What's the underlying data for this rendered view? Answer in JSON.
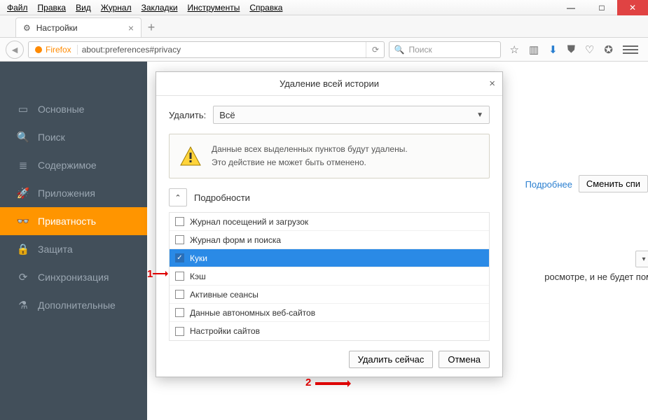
{
  "menubar": [
    "Файл",
    "Правка",
    "Вид",
    "Журнал",
    "Закладки",
    "Инструменты",
    "Справка"
  ],
  "tab": {
    "title": "Настройки"
  },
  "url": {
    "identity": "Firefox",
    "address": "about:preferences#privacy",
    "search_placeholder": "Поиск"
  },
  "sidebar": {
    "items": [
      {
        "icon": "▭",
        "label": "Основные"
      },
      {
        "icon": "🔍",
        "label": "Поиск"
      },
      {
        "icon": "≣",
        "label": "Содержимое"
      },
      {
        "icon": "🚀",
        "label": "Приложения"
      },
      {
        "icon": "👓",
        "label": "Приватность"
      },
      {
        "icon": "🔒",
        "label": "Защита"
      },
      {
        "icon": "⟳",
        "label": "Синхронизация"
      },
      {
        "icon": "⚗",
        "label": "Дополнительные"
      }
    ],
    "active_index": 4
  },
  "background": {
    "link": "Подробнее",
    "button": "Сменить спи",
    "text": "росмотре, и не будет пом"
  },
  "dialog": {
    "title": "Удаление всей истории",
    "delete_label": "Удалить:",
    "delete_value": "Всё",
    "warning_line1": "Данные всех выделенных пунктов будут удалены.",
    "warning_line2": "Это действие не может быть отменено.",
    "details_label": "Подробности",
    "items": [
      {
        "label": "Журнал посещений и загрузок",
        "checked": false,
        "selected": false
      },
      {
        "label": "Журнал форм и поиска",
        "checked": false,
        "selected": false
      },
      {
        "label": "Куки",
        "checked": true,
        "selected": true
      },
      {
        "label": "Кэш",
        "checked": false,
        "selected": false
      },
      {
        "label": "Активные сеансы",
        "checked": false,
        "selected": false
      },
      {
        "label": "Данные автономных веб-сайтов",
        "checked": false,
        "selected": false
      },
      {
        "label": "Настройки сайтов",
        "checked": false,
        "selected": false
      }
    ],
    "primary_button": "Удалить сейчас",
    "cancel_button": "Отмена"
  },
  "annotations": {
    "one": "1",
    "two": "2"
  }
}
